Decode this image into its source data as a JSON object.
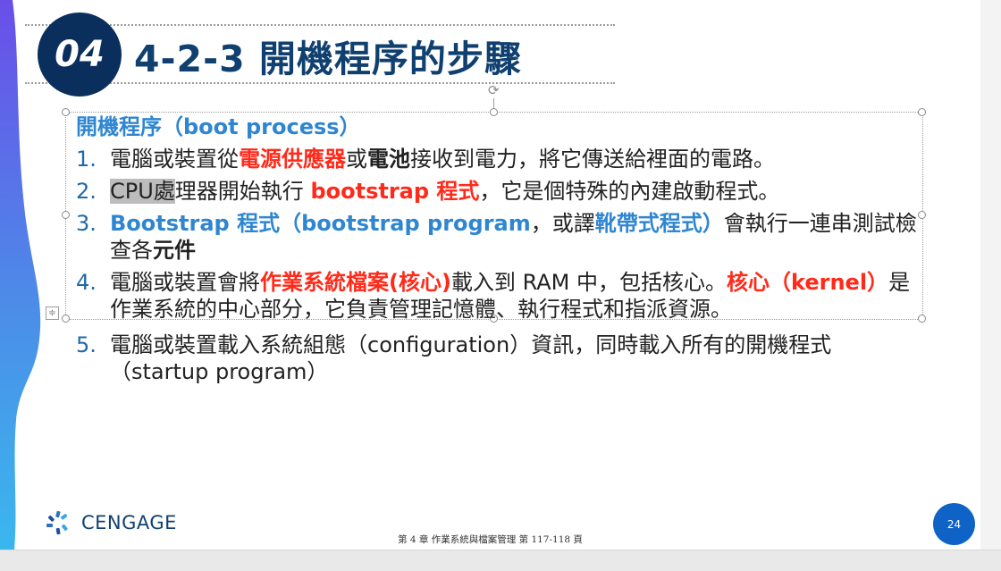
{
  "slide": {
    "badge": "04",
    "title": "4-2-3 開機程序的步驟",
    "subhead": "開機程序（boot process）",
    "items": [
      {
        "num": "1.",
        "p1": "電腦或裝置從",
        "r1": "電源供應器",
        "p2": "或",
        "b1": "電池",
        "p3": "接收到電力，將它傳送給裡面的電路。"
      },
      {
        "num": "2.",
        "hl": "CPU處",
        "p1": "理器開始執行 ",
        "r1": "bootstrap 程式",
        "p2": "，它是個特殊的內建啟動程式。"
      },
      {
        "num": "3.",
        "bl1": "Bootstrap 程式（bootstrap program",
        "p1": "，或譯",
        "bl2": "靴帶式程式）",
        "p2": "會執行一連串測試檢查各",
        "b1": "元件"
      },
      {
        "num": "4.",
        "p1": "電腦或裝置會將",
        "r1": "作業系統檔案(核心)",
        "p2": "載入到 RAM 中，包括核心。",
        "r2": "核心（kernel）",
        "p3": "是作業系統的中心部分，它負責管理記憶體、執行程式和指派資源。"
      },
      {
        "num": "5.",
        "p1": "電腦或裝置載入系統組態（configuration）資訊，同時載入所有的開機程式（startup program）"
      }
    ],
    "logo_text": "CENGAGE",
    "footer": "第 4 章  作業系統與檔案管理  第 117-118 頁",
    "page_number": "24"
  },
  "colors": {
    "title": "#10406f",
    "badge": "#0b2f5c",
    "accent_red": "#ff2a1a",
    "accent_blue": "#2f86d0",
    "page_badge": "#0f63c7"
  },
  "icons": {
    "rotate_handle": "rotate-icon",
    "layout_options": "layout-options-icon",
    "logo": "cengage-logo-icon"
  }
}
